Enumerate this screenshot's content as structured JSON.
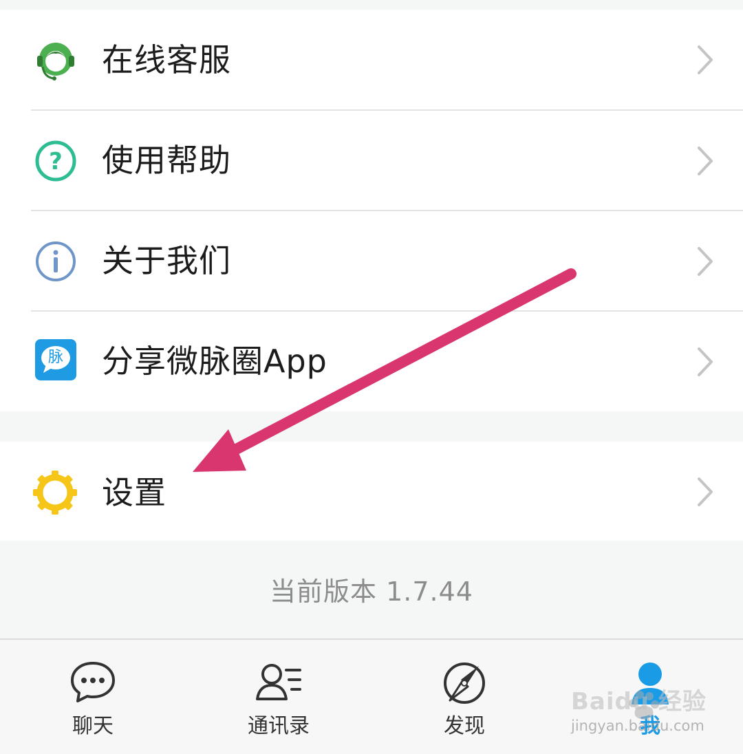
{
  "menu": {
    "items": [
      {
        "label": "在线客服",
        "icon": "headset-support-icon"
      },
      {
        "label": "使用帮助",
        "icon": "question-circle-icon"
      },
      {
        "label": "关于我们",
        "icon": "info-circle-icon"
      },
      {
        "label": "分享微脉圈App",
        "icon": "app-logo-icon",
        "icon_text": "脉"
      }
    ],
    "settings": {
      "label": "设置",
      "icon": "gear-icon"
    }
  },
  "version_text": "当前版本 1.7.44",
  "tabbar": {
    "tabs": [
      {
        "label": "聊天",
        "icon": "chat-bubble-icon"
      },
      {
        "label": "通讯录",
        "icon": "contacts-icon"
      },
      {
        "label": "发现",
        "icon": "discover-compass-icon"
      },
      {
        "label": "我",
        "icon": "profile-icon",
        "active": true
      }
    ]
  },
  "watermark": {
    "brand": "Baidu 经验",
    "url": "jingyan.baidu.com"
  },
  "colors": {
    "accent": "#1a9be6",
    "annotation_arrow": "#d9356e",
    "support_green": "#4caf50",
    "help_teal": "#2ebd93",
    "info_blue": "#6f95c9",
    "app_blue": "#1e9be3",
    "gear_yellow": "#f5c518"
  }
}
